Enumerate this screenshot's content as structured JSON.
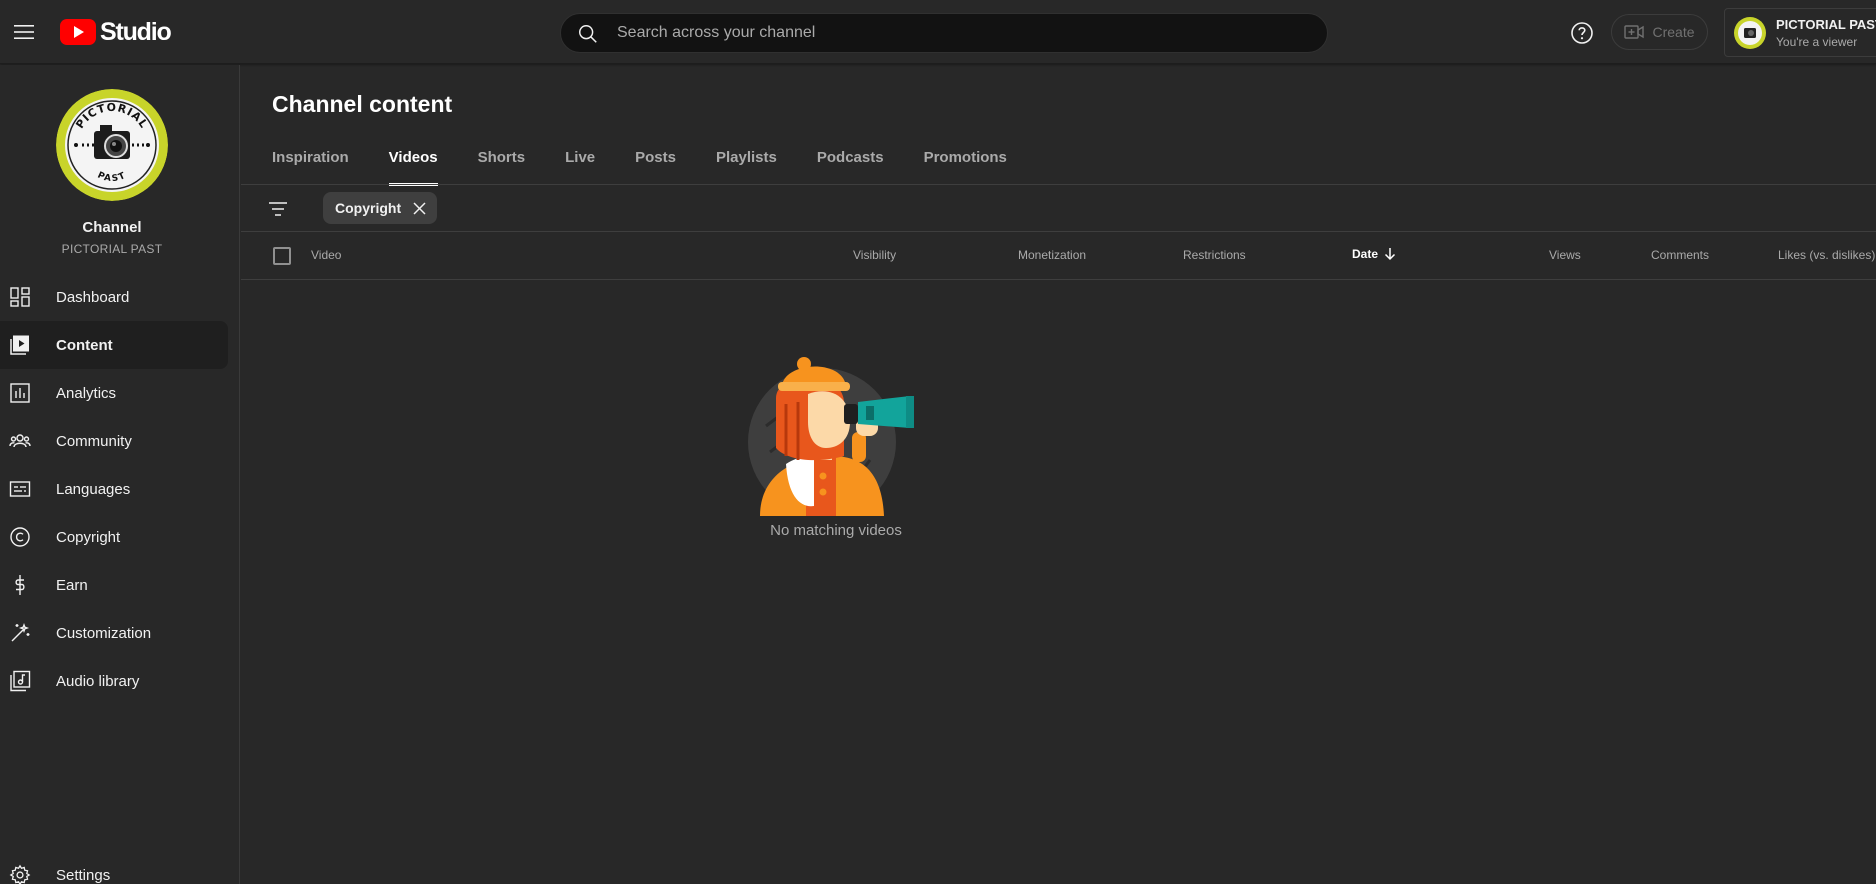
{
  "header": {
    "logo_text": "Studio",
    "search_placeholder": "Search across your channel",
    "create_label": "Create",
    "account": {
      "name": "PICTORIAL PAST",
      "role": "You're a viewer"
    }
  },
  "sidebar": {
    "channel_label": "Channel",
    "channel_name": "PICTORIAL PAST",
    "avatar_text_top": "PICTORIAL",
    "avatar_text_bottom": "PAST",
    "items": [
      {
        "label": "Dashboard",
        "icon": "dashboard-icon",
        "active": false
      },
      {
        "label": "Content",
        "icon": "content-icon",
        "active": true
      },
      {
        "label": "Analytics",
        "icon": "analytics-icon",
        "active": false
      },
      {
        "label": "Community",
        "icon": "community-icon",
        "active": false
      },
      {
        "label": "Languages",
        "icon": "languages-icon",
        "active": false
      },
      {
        "label": "Copyright",
        "icon": "copyright-icon",
        "active": false
      },
      {
        "label": "Earn",
        "icon": "earn-icon",
        "active": false
      },
      {
        "label": "Customization",
        "icon": "customization-icon",
        "active": false
      },
      {
        "label": "Audio library",
        "icon": "audio-library-icon",
        "active": false
      }
    ],
    "settings_label": "Settings"
  },
  "main": {
    "title": "Channel content",
    "tabs": [
      {
        "label": "Inspiration",
        "active": false
      },
      {
        "label": "Videos",
        "active": true
      },
      {
        "label": "Shorts",
        "active": false
      },
      {
        "label": "Live",
        "active": false
      },
      {
        "label": "Posts",
        "active": false
      },
      {
        "label": "Playlists",
        "active": false
      },
      {
        "label": "Podcasts",
        "active": false
      },
      {
        "label": "Promotions",
        "active": false
      }
    ],
    "filter_chip": "Copyright",
    "columns": {
      "video": "Video",
      "visibility": "Visibility",
      "monetization": "Monetization",
      "restrictions": "Restrictions",
      "date": "Date",
      "views": "Views",
      "comments": "Comments",
      "likes": "Likes (vs. dislikes)"
    },
    "empty_message": "No matching videos"
  },
  "colors": {
    "background": "#282828",
    "brand_red": "#ff0000",
    "accent_orange": "#f7931e",
    "avatar_yellow": "#c8d42a"
  }
}
